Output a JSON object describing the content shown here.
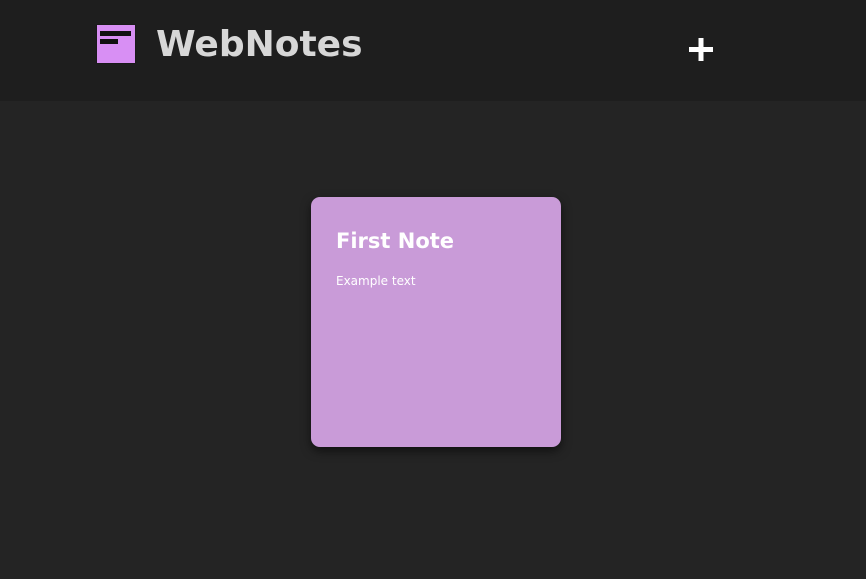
{
  "app": {
    "title": "WebNotes",
    "logo_icon": "sticky-note-icon",
    "add_icon": "plus-icon",
    "colors": {
      "background": "#242424",
      "header": "#1e1e1e",
      "note": "#c99bd8",
      "logo": "#d88ff4"
    }
  },
  "notes": [
    {
      "title": "First Note",
      "body": "Example text"
    }
  ]
}
